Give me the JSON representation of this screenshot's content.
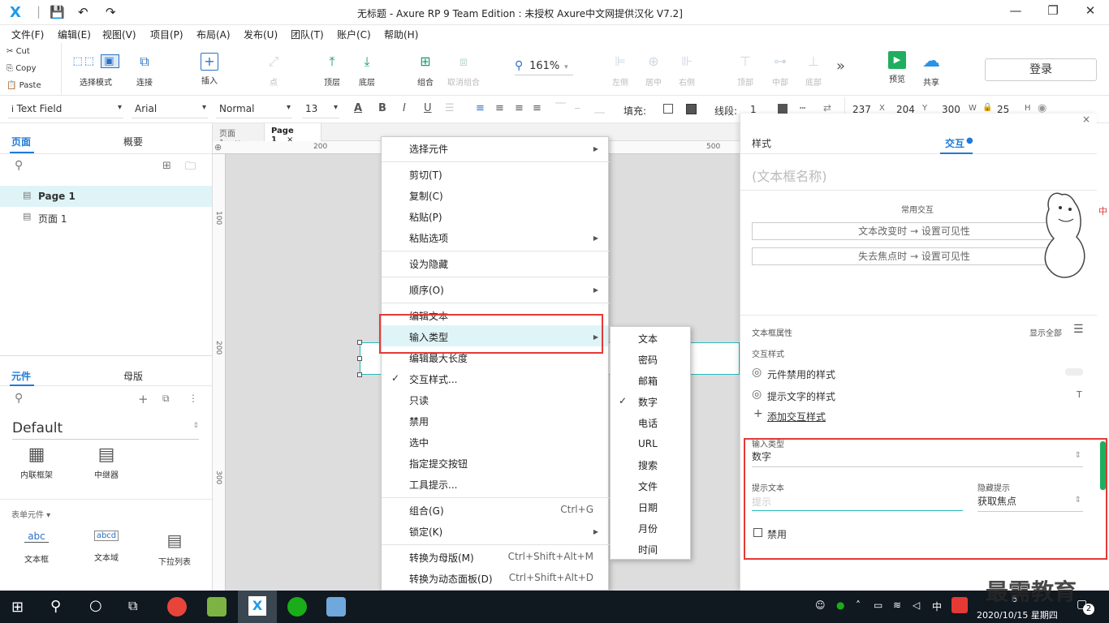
{
  "window": {
    "title": "无标题 - Axure RP 9 Team Edition : 未授权     Axure中文网提供汉化 V7.2]",
    "logo": "X",
    "minimize": "—",
    "maximize": "❐",
    "close": "✕"
  },
  "menubar": [
    "文件(F)",
    "编辑(E)",
    "视图(V)",
    "项目(P)",
    "布局(A)",
    "发布(U)",
    "团队(T)",
    "账户(C)",
    "帮助(H)"
  ],
  "clipboard": {
    "cut": "Cut",
    "copy": "Copy",
    "paste": "Paste"
  },
  "toolbar": {
    "select_mode": "选择模式",
    "connect": "连接",
    "insert": "插入",
    "point": "点",
    "top_layer": "顶层",
    "bottom_layer": "底层",
    "group": "组合",
    "ungroup": "取消组合",
    "zoom": "161%",
    "align_left": "左侧",
    "align_center": "居中",
    "align_right": "右侧",
    "align_top": "顶部",
    "align_middle": "中部",
    "align_bottom": "底部",
    "more": "»",
    "preview": "预览",
    "share": "共享",
    "login": "登录"
  },
  "format": {
    "widget_type": "Text Field",
    "font": "Arial",
    "weight": "Normal",
    "size": "13",
    "fill_label": "填充:",
    "stroke_label": "线段:",
    "stroke_value": "1",
    "x": "237",
    "x_label": "X",
    "y": "204",
    "y_label": "Y",
    "w": "300",
    "w_label": "W",
    "h": "25",
    "h_label": "H"
  },
  "left": {
    "tabs": {
      "pages": "页面",
      "outline": "概要"
    },
    "pages": [
      "Page 1",
      "页面 1"
    ],
    "lib_tabs": {
      "widgets": "元件",
      "masters": "母版"
    },
    "library": "Default",
    "widgets": [
      "内联框架",
      "中继器"
    ],
    "form_section": "表单元件 ▾",
    "form_widgets": [
      "文本框",
      "文本域",
      "下拉列表"
    ]
  },
  "canvas": {
    "tabs": [
      "页面 1",
      "Page 1"
    ],
    "ruler_top": [
      "200",
      "500"
    ],
    "ruler_left": [
      "100",
      "200",
      "300"
    ]
  },
  "context_menu": {
    "items": [
      "选择元件",
      "剪切(T)",
      "复制(C)",
      "粘贴(P)",
      "粘贴选项",
      "设为隐藏",
      "顺序(O)",
      "编辑文本",
      "输入类型",
      "编辑最大长度",
      "交互样式...",
      "只读",
      "禁用",
      "选中",
      "指定提交按钮",
      "工具提示...",
      "组合(G)",
      "锁定(K)",
      "转换为母版(M)",
      "转换为动态面板(D)"
    ],
    "shortcuts": {
      "group": "Ctrl+G",
      "master": "Ctrl+Shift+Alt+M",
      "panel": "Ctrl+Shift+Alt+D"
    },
    "check": "✓"
  },
  "submenu": [
    "文本",
    "密码",
    "邮箱",
    "数字",
    "电话",
    "URL",
    "搜索",
    "文件",
    "日期",
    "月份",
    "时间"
  ],
  "right": {
    "tabs": {
      "style": "样式",
      "interaction": "交互"
    },
    "name_placeholder": "(文本框名称)",
    "common_interactions": "常用交互",
    "interaction1": "文本改变时 → 设置可见性",
    "interaction2": "失去焦点时 → 设置可见性",
    "props_label": "文本框属性",
    "show_all": "显示全部",
    "interaction_styles": "交互样式",
    "disabled_style": "元件禁用的样式",
    "hint_style": "提示文字的样式",
    "add_style": "添加交互样式",
    "input_type_label": "输入类型",
    "input_type_value": "数字",
    "hint_text_label": "提示文本",
    "hint_text_placeholder": "提示",
    "hide_hint_label": "隐藏提示",
    "hide_hint_value": "获取焦点",
    "disabled_label": "禁用"
  },
  "taskbar": {
    "ime": "中",
    "time": "6",
    "date": "2020/10/15 星期四",
    "badge": "2",
    "watermark": "最需教育"
  }
}
